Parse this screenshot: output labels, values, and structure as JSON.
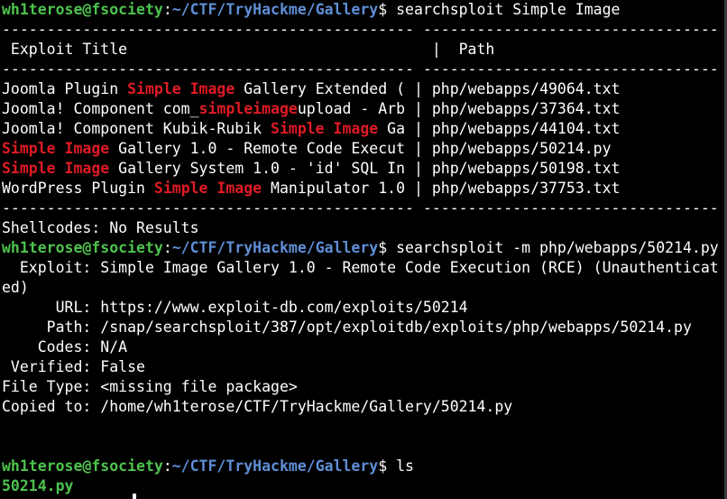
{
  "prompt": {
    "user": "wh1terose@fsociety",
    "sep": ":",
    "dollar": "$ ",
    "path": "~/CTF/TryHackme/Gallery"
  },
  "cmd1": "searchsploit Simple Image",
  "divider": "---------------------------------------------- ---------------------------------",
  "header": {
    "title": " Exploit Title                                  |  Path"
  },
  "results": [
    {
      "pre": "Joomla Plugin ",
      "hl": "Simple Image",
      "post": " Gallery Extended ( ",
      "pipe": "| ",
      "path": "php/webapps/49064.txt"
    },
    {
      "pre": "Joomla! Component com_",
      "hl": "simpleimage",
      "post": "upload - Arb ",
      "pipe": "| ",
      "path": "php/webapps/37364.txt"
    },
    {
      "pre": "Joomla! Component Kubik-Rubik ",
      "hl": "Simple Image",
      "post": " Ga ",
      "pipe": "| ",
      "path": "php/webapps/44104.txt"
    },
    {
      "pre": "",
      "hl": "Simple Image",
      "post": " Gallery 1.0 - Remote Code Execut ",
      "pipe": "| ",
      "path": "php/webapps/50214.py"
    },
    {
      "pre": "",
      "hl": "Simple Image",
      "post": " Gallery System 1.0 - 'id' SQL In ",
      "pipe": "| ",
      "path": "php/webapps/50198.txt"
    },
    {
      "pre": "WordPress Plugin ",
      "hl": "Simple Image",
      "post": " Manipulator 1.0 ",
      "pipe": "| ",
      "path": "php/webapps/37753.txt"
    }
  ],
  "shellcodes": "Shellcodes: No Results",
  "cmd2": "searchsploit -m php/webapps/50214.py",
  "mirror": {
    "exploit_line1": "  Exploit: Simple Image Gallery 1.0 - Remote Code Execution (RCE) (Unauthenticat",
    "exploit_line2": "ed)",
    "url": "      URL: https://www.exploit-db.com/exploits/50214",
    "path": "     Path: /snap/searchsploit/387/opt/exploitdb/exploits/php/webapps/50214.py",
    "codes": "    Codes: N/A",
    "verified": " Verified: False",
    "filetype": "File Type: <missing file package>",
    "copied": "Copied to: /home/wh1terose/CTF/TryHackme/Gallery/50214.py"
  },
  "cmd3": "ls",
  "ls_output": "50214.py",
  "colors": {
    "user": "#4ec24e",
    "path": "#5f8fd6",
    "highlight": "#e01b24",
    "text": "#ffffff",
    "background": "#000000"
  }
}
